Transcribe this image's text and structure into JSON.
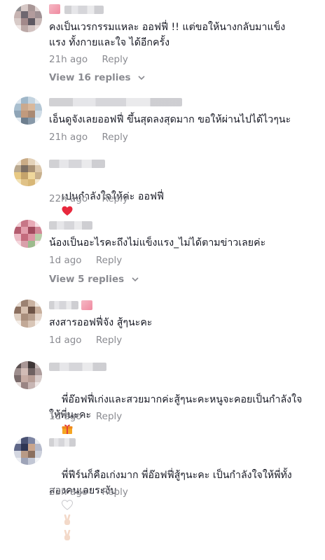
{
  "comments": [
    {
      "text": "คงเป็นเวรกรรมแหละ ออฟฟี่ !! แต่ขอให้นางกลับมาแข็ง\nแรง ทั้งกายและใจ ได้อีกครั้ง",
      "time": "21h ago",
      "reply": "Reply",
      "view_replies": "View 16 replies"
    },
    {
      "text": "เอ็นดูจังเลยออฟฟี่ ขึ้นสุดลงสุดมาก ขอให้ผ่านไปได้ไวๆนะ",
      "time": "21h ago",
      "reply": "Reply"
    },
    {
      "text": "เปนกำลังใจให้ค่ะ ออฟฟี่",
      "emoji": "red-heart-icon",
      "time": "22h ago",
      "reply": "Reply"
    },
    {
      "text": "น้องเป็นอะไรคะถึงไม่แข็งแรง_ไม่ได้ตามข่าวเลยค่ะ",
      "time": "1d ago",
      "reply": "Reply",
      "view_replies": "View 5 replies"
    },
    {
      "text": "สงสารออฟฟี่จัง สู้ๆนะคะ",
      "time": "1d ago",
      "reply": "Reply"
    },
    {
      "text": "พี่อ๊อฟฟี่เก่งและสวยมากค่ะสู้ๆนะคะหนูจะคอยเป็นกำลังใจ\nให้พี่นะคะ",
      "emoji": "gift-icon",
      "time": "1d ago",
      "reply": "Reply"
    },
    {
      "text": "พี่ฟีร์นก็คือเก่งมาก พี่อ๊อฟฟี่สู้ๆนะคะ เป็นกำลังใจให้พี่ทั้ง\nสองคนเลยระงับ",
      "emoji": "white-heart-victory-hands-icon",
      "time": "23h ago",
      "reply": "Reply"
    }
  ],
  "colors": {
    "text": "#161823",
    "meta": "#8a8b91",
    "heart": "#e8283d",
    "gift": "#f5a623"
  }
}
